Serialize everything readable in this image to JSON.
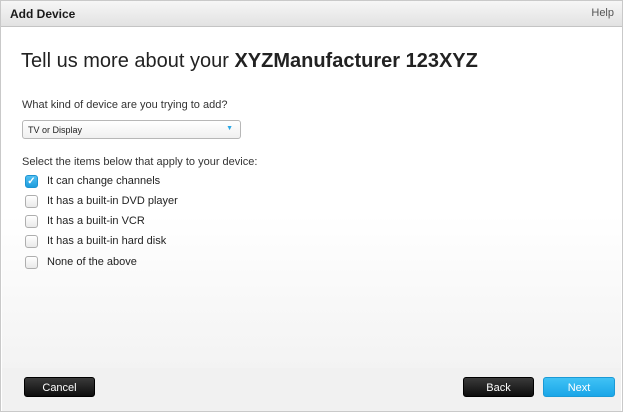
{
  "window": {
    "title": "Add Device",
    "help_label": "Help"
  },
  "heading": {
    "prefix": "Tell us more about your ",
    "device_name": "XYZManufacturer 123XYZ"
  },
  "device_type": {
    "question": "What kind of device are you trying to add?",
    "selected": "TV or Display"
  },
  "features": {
    "instruction": "Select the items below that apply to your device:",
    "options": [
      {
        "label": "It can change channels",
        "checked": true
      },
      {
        "label": "It has a built-in DVD player",
        "checked": false
      },
      {
        "label": "It has a built-in VCR",
        "checked": false
      },
      {
        "label": "It has a built-in hard disk",
        "checked": false
      },
      {
        "label": "None of the above",
        "checked": false
      }
    ]
  },
  "footer": {
    "cancel_label": "Cancel",
    "back_label": "Back",
    "next_label": "Next"
  },
  "colors": {
    "accent": "#1fa3e6",
    "dark_button": "#1a1a1a"
  }
}
